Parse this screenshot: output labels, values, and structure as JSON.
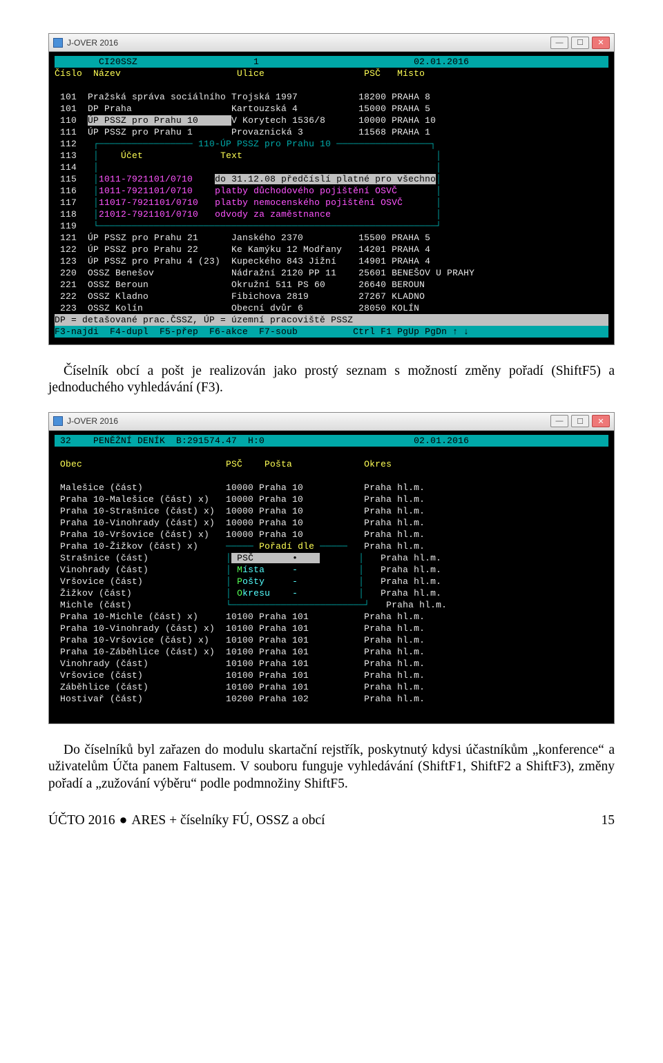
{
  "win1": {
    "title": "J-OVER 2016",
    "headerLeft": "        CI20SSZ",
    "headerMid": "1",
    "headerRight": "02.01.2016",
    "cols": {
      "cislo": "Číslo",
      "nazev": "Název",
      "ulice": "Ulice",
      "psc": "PSČ",
      "misto": "Místo"
    },
    "rows": [
      {
        "c": "101",
        "n": "Pražská správa sociálního",
        "u": "Trojská 1997",
        "p": "18200",
        "m": "PRAHA 8"
      },
      {
        "c": "101",
        "n": "DP Praha",
        "u": "Kartouzská 4",
        "p": "15000",
        "m": "PRAHA 5"
      },
      {
        "c": "110",
        "n": "ÚP PSSZ pro Prahu 10",
        "u": "V Korytech 1536/8",
        "p": "10000",
        "m": "PRAHA 10",
        "sel": true
      },
      {
        "c": "111",
        "n": "ÚP PSSZ pro Prahu 1",
        "u": "Provaznická 3",
        "p": "11568",
        "m": "PRAHA 1"
      },
      {
        "c": "112"
      },
      {
        "c": "113"
      },
      {
        "c": "114"
      },
      {
        "c": "115"
      },
      {
        "c": "116"
      },
      {
        "c": "117"
      },
      {
        "c": "118"
      },
      {
        "c": "119"
      },
      {
        "c": "121",
        "n": "ÚP PSSZ pro Prahu 21",
        "u": "Janského 2370",
        "p": "15500",
        "m": "PRAHA 5"
      },
      {
        "c": "122",
        "n": "ÚP PSSZ pro Prahu 22",
        "u": "Ke Kamýku 12 Modřany",
        "p": "14201",
        "m": "PRAHA 4"
      },
      {
        "c": "123",
        "n": "ÚP PSSZ pro Prahu 4 (23)",
        "u": "Kupeckého 843 Jižní",
        "p": "14901",
        "m": "PRAHA 4"
      },
      {
        "c": "220",
        "n": "OSSZ Benešov",
        "u": "Nádražní 2120 PP 11",
        "p": "25601",
        "m": "BENEŠOV U PRAHY"
      },
      {
        "c": "221",
        "n": "OSSZ Beroun",
        "u": "Okružní 511 PS 60",
        "p": "26640",
        "m": "BEROUN"
      },
      {
        "c": "222",
        "n": "OSSZ Kladno",
        "u": "Fibichova 2819",
        "p": "27267",
        "m": "KLADNO"
      },
      {
        "c": "223",
        "n": "OSSZ Kolín",
        "u": "Obecní dvůr 6",
        "p": "28050",
        "m": "KOLÍN"
      }
    ],
    "popup": {
      "title": "110-ÚP PSSZ pro Prahu 10",
      "h1": "Účet",
      "h2": "Text",
      "rows": [
        {
          "a": "1011-7921101/0710",
          "t": "do 31.12.08 předčíslí platné pro všechno",
          "sel": true
        },
        {
          "a": "1011-7921101/0710",
          "t": "platby důchodového pojištění OSVČ"
        },
        {
          "a": "11017-7921101/0710",
          "t": "platby nemocenského pojištění OSVČ"
        },
        {
          "a": "21012-7921101/0710",
          "t": "odvody za zaměstnance"
        }
      ]
    },
    "footer1": "DP = detašované prac.ČSSZ, ÚP = územní pracoviště PSSZ",
    "footer2": "F3-najdi  F4-dupl  F5-přep  F6-akce  F7-soub          Ctrl F1 PgUp PgDn ↑ ↓"
  },
  "para1": "Číselník obcí a pošt je realizován jako prostý seznam s možností změny pořadí (ShiftF5) a jednoduchého vyhledávání (F3).",
  "win2": {
    "title": "J-OVER 2016",
    "headerLeft": " 32    PENĚŽNÍ DENÍK  B:291574.47  H:0",
    "headerRight": "02.01.2016",
    "cols": {
      "obec": "Obec",
      "psc": "PSČ",
      "posta": "Pošta",
      "okres": "Okres"
    },
    "rows": [
      {
        "o": "Malešice (část)",
        "p": "10000",
        "po": "Praha 10",
        "ok": "Praha hl.m."
      },
      {
        "o": "Praha 10-Malešice (část) x)",
        "p": "10000",
        "po": "Praha 10",
        "ok": "Praha hl.m."
      },
      {
        "o": "Praha 10-Strašnice (část) x)",
        "p": "10000",
        "po": "Praha 10",
        "ok": "Praha hl.m."
      },
      {
        "o": "Praha 10-Vinohrady (část) x)",
        "p": "10000",
        "po": "Praha 10",
        "ok": "Praha hl.m."
      },
      {
        "o": "Praha 10-Vršovice (část) x)",
        "p": "10000",
        "po": "Praha 10",
        "ok": "Praha hl.m."
      },
      {
        "o": "Praha 10-Žižkov (část) x)",
        "p": "",
        "po": "",
        "ok": "Praha hl.m."
      },
      {
        "o": "Strašnice (část)",
        "p": "",
        "po": "",
        "ok": "Praha hl.m."
      },
      {
        "o": "Vinohrady (část)",
        "p": "",
        "po": "",
        "ok": "Praha hl.m."
      },
      {
        "o": "Vršovice (část)",
        "p": "",
        "po": "",
        "ok": "Praha hl.m."
      },
      {
        "o": "Žižkov (část)",
        "p": "",
        "po": "",
        "ok": "Praha hl.m."
      },
      {
        "o": "Michle (část)",
        "p": "",
        "po": "",
        "ok": "Praha hl.m."
      },
      {
        "o": "Praha 10-Michle (část) x)",
        "p": "10100",
        "po": "Praha 101",
        "ok": "Praha hl.m."
      },
      {
        "o": "Praha 10-Vinohrady (část) x)",
        "p": "10100",
        "po": "Praha 101",
        "ok": "Praha hl.m."
      },
      {
        "o": "Praha 10-Vršovice (část) x)",
        "p": "10100",
        "po": "Praha 101",
        "ok": "Praha hl.m."
      },
      {
        "o": "Praha 10-Záběhlice (část) x)",
        "p": "10100",
        "po": "Praha 101",
        "ok": "Praha hl.m."
      },
      {
        "o": "Vinohrady (část)",
        "p": "10100",
        "po": "Praha 101",
        "ok": "Praha hl.m."
      },
      {
        "o": "Vršovice (část)",
        "p": "10100",
        "po": "Praha 101",
        "ok": "Praha hl.m."
      },
      {
        "o": "Záběhlice (část)",
        "p": "10100",
        "po": "Praha 101",
        "ok": "Praha hl.m."
      },
      {
        "o": "Hostivař (část)",
        "p": "10200",
        "po": "Praha 102",
        "ok": "Praha hl.m."
      }
    ],
    "popup": {
      "title": "Pořadí dle",
      "items": [
        {
          "k": "P",
          "t": "SČ",
          "mark": "•",
          "sel": true
        },
        {
          "k": "M",
          "t": "ísta",
          "mark": "-"
        },
        {
          "k": "P",
          "t": "ošty",
          "mark": "-"
        },
        {
          "k": "O",
          "t": "kresu",
          "mark": "-"
        }
      ]
    }
  },
  "para2": "Do číselníků byl zařazen do modulu skartační rejstřík, poskytnutý kdysi účastníkům „konference“ a uživatelům Účta panem Faltusem. V souboru funguje vyhledávání (ShiftF1, ShiftF2 a ShiftF3), změny pořadí a „zužování výběru“ podle podmnožiny ShiftF5.",
  "footer": {
    "a": "ÚČTO 2016",
    "b": "ARES + číselníky FÚ, OSSZ a obcí",
    "pn": "15"
  }
}
